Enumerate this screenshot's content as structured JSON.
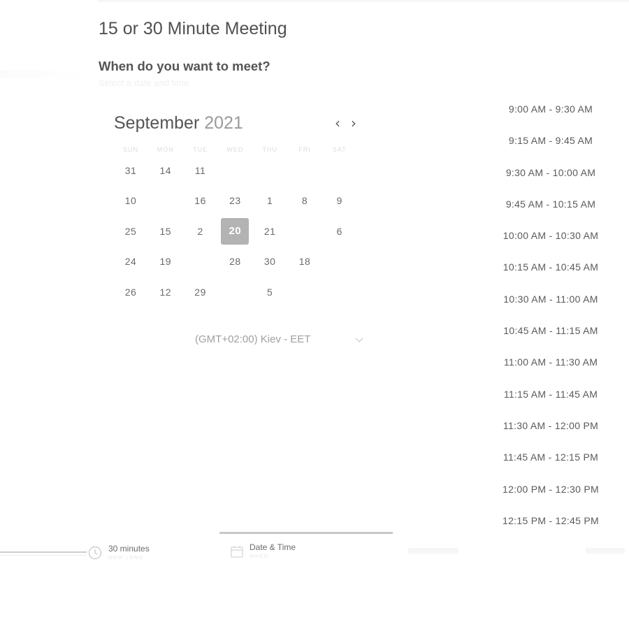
{
  "meeting": {
    "title": "15 or 30 Minute Meeting",
    "question": "When do you want to meet?",
    "subtitle": "Select a date and time"
  },
  "calendar": {
    "month": "September",
    "year": "2021",
    "prev_icon": "chevron-left-icon",
    "next_icon": "chevron-right-icon",
    "weekdays": [
      "SUN",
      "MON",
      "TUE",
      "WED",
      "THU",
      "FRI",
      "SAT"
    ],
    "weeks": [
      [
        {
          "label": "31",
          "faint": false
        },
        {
          "label": "14",
          "faint": false
        },
        {
          "label": "11",
          "faint": false
        },
        {
          "label": "",
          "faint": true
        },
        {
          "label": "",
          "faint": true
        },
        {
          "label": "",
          "faint": true
        },
        {
          "label": "",
          "faint": true
        }
      ],
      [
        {
          "label": "10",
          "faint": false
        },
        {
          "label": "",
          "faint": true
        },
        {
          "label": "16",
          "faint": false
        },
        {
          "label": "23",
          "faint": false
        },
        {
          "label": "1",
          "faint": false
        },
        {
          "label": "8",
          "faint": false
        },
        {
          "label": "9",
          "faint": false
        }
      ],
      [
        {
          "label": "25",
          "faint": false
        },
        {
          "label": "15",
          "faint": false
        },
        {
          "label": "2",
          "faint": false
        },
        {
          "label": "20",
          "faint": false,
          "selected": true
        },
        {
          "label": "21",
          "faint": false
        },
        {
          "label": "",
          "faint": true
        },
        {
          "label": "6",
          "faint": false
        }
      ],
      [
        {
          "label": "24",
          "faint": false
        },
        {
          "label": "19",
          "faint": false
        },
        {
          "label": "",
          "faint": true
        },
        {
          "label": "28",
          "faint": false
        },
        {
          "label": "30",
          "faint": false
        },
        {
          "label": "18",
          "faint": false
        },
        {
          "label": "",
          "faint": true
        }
      ],
      [
        {
          "label": "26",
          "faint": false
        },
        {
          "label": "12",
          "faint": false
        },
        {
          "label": "29",
          "faint": false
        },
        {
          "label": "",
          "faint": true
        },
        {
          "label": "5",
          "faint": false
        },
        {
          "label": "",
          "faint": true
        },
        {
          "label": "",
          "faint": true
        }
      ]
    ],
    "selected_day": "20"
  },
  "timezone": {
    "value": "(GMT+02:00) Kiev - EET",
    "icon": "chevron-down-icon"
  },
  "time_slots": [
    "9:00 AM - 9:30 AM",
    "9:15 AM - 9:45 AM",
    "9:30 AM - 10:00 AM",
    "9:45 AM - 10:15 AM",
    "10:00 AM - 10:30 AM",
    "10:15 AM - 10:45 AM",
    "10:30 AM - 11:00 AM",
    "10:45 AM - 11:15 AM",
    "11:00 AM - 11:30 AM",
    "11:15 AM - 11:45 AM",
    "11:30 AM - 12:00 PM",
    "11:45 AM - 12:15 PM",
    "12:00 PM - 12:30 PM",
    "12:15 PM - 12:45 PM"
  ],
  "steps": {
    "duration": {
      "label": "30 minutes",
      "sub": "HOW LONG",
      "icon": "clock-icon"
    },
    "datetime": {
      "label": "Date & Time",
      "sub": "WHEN",
      "icon": "calendar-icon"
    }
  },
  "colors": {
    "selected_day_bg": "#b3b3b3",
    "text": "#4a4a4a",
    "active_step_bar": "#c8c8c8"
  }
}
